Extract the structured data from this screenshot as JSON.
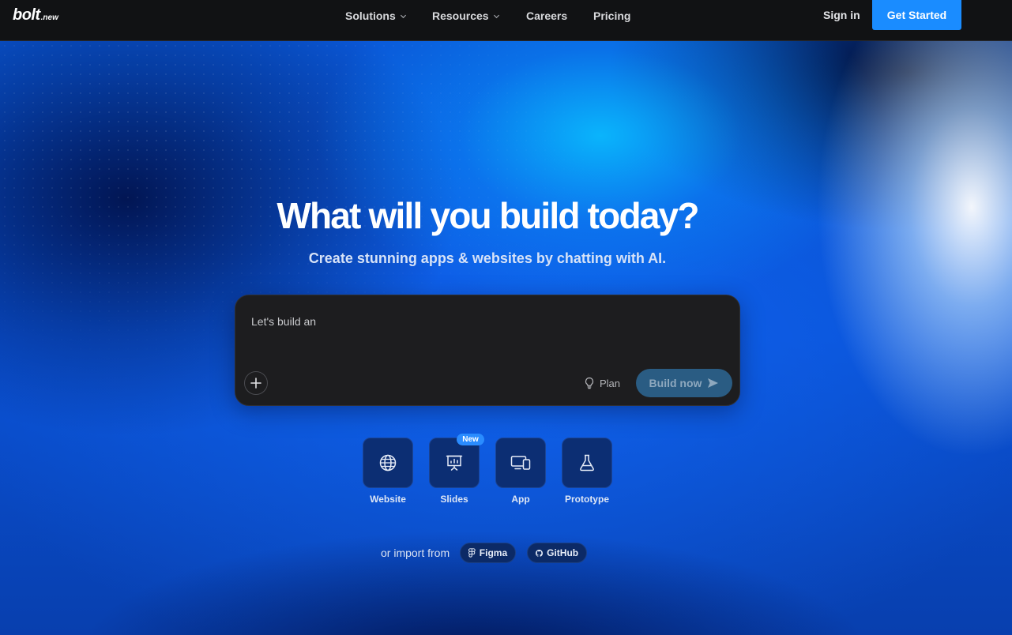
{
  "nav": {
    "logo": "bolt",
    "logo_suffix": ".new",
    "links": [
      {
        "label": "Solutions",
        "icon": "chevron-down-icon"
      },
      {
        "label": "Resources",
        "icon": "chevron-down-icon"
      },
      {
        "label": "Careers"
      },
      {
        "label": "Pricing"
      }
    ],
    "sign_in": "Sign in",
    "get_started": "Get Started"
  },
  "hero": {
    "title": "What will you build today?",
    "subtitle": "Create stunning apps & websites by chatting with AI."
  },
  "prompt": {
    "placeholder": "Let's build an",
    "plus_icon": "plus-icon",
    "plan_label": "Plan",
    "plan_icon": "lightbulb-icon",
    "build_label": "Build now",
    "build_icon": "send-arrow-icon"
  },
  "categories": [
    {
      "label": "Website",
      "icon": "globe-icon"
    },
    {
      "label": "Slides",
      "icon": "presentation-chart-icon",
      "badge": "New"
    },
    {
      "label": "App",
      "icon": "devices-icon"
    },
    {
      "label": "Prototype",
      "icon": "flask-icon"
    }
  ],
  "import": {
    "text": "or import from",
    "figma": "Figma",
    "github": "GitHub"
  },
  "colors": {
    "accent": "#1a8cff",
    "nav_bg": "#111214",
    "prompt_bg": "#1d1d1f",
    "tile_bg": "#0c2e73",
    "build_btn_bg": "#2a5c83"
  }
}
